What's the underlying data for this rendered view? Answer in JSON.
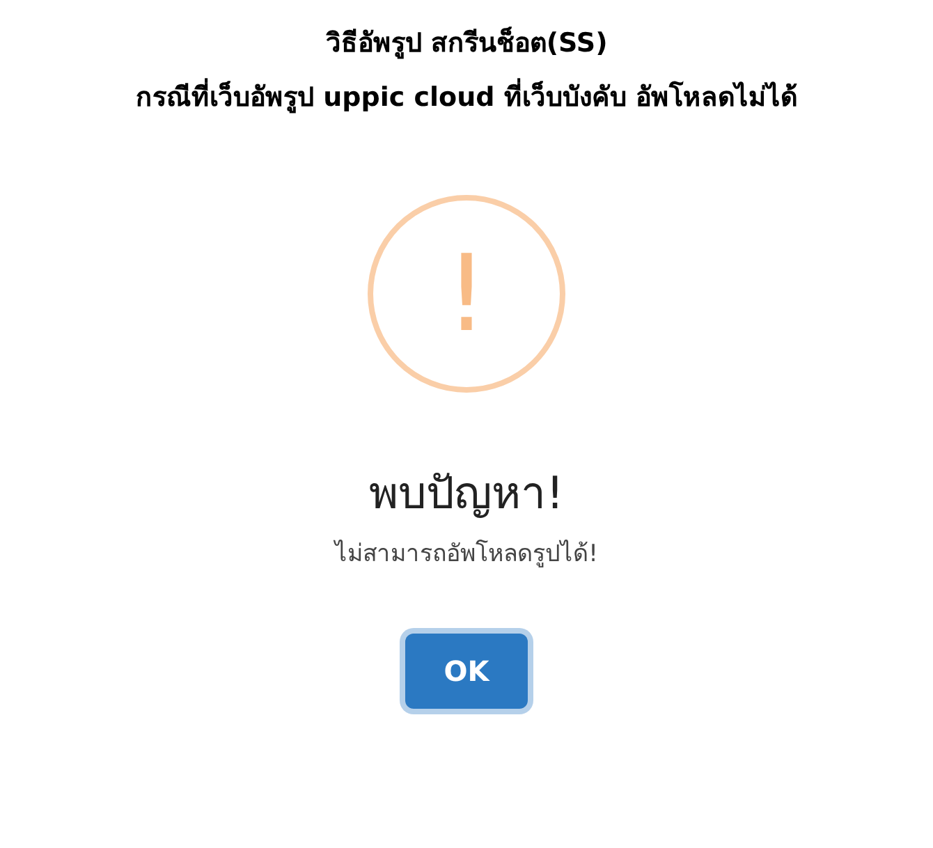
{
  "heading": [
    "วิธีอัพรูป สกรีนช็อต(SS)",
    "กรณีที่เว็บอัพรูป uppic cloud ที่เว็บบังคับ อัพโหลดไม่ได้"
  ],
  "alert": {
    "kind": "warning",
    "icon": "!",
    "title": "พบปัญหา!",
    "message": "ไม่สามารถอัพโหลดรูปได้!",
    "button": "OK"
  }
}
